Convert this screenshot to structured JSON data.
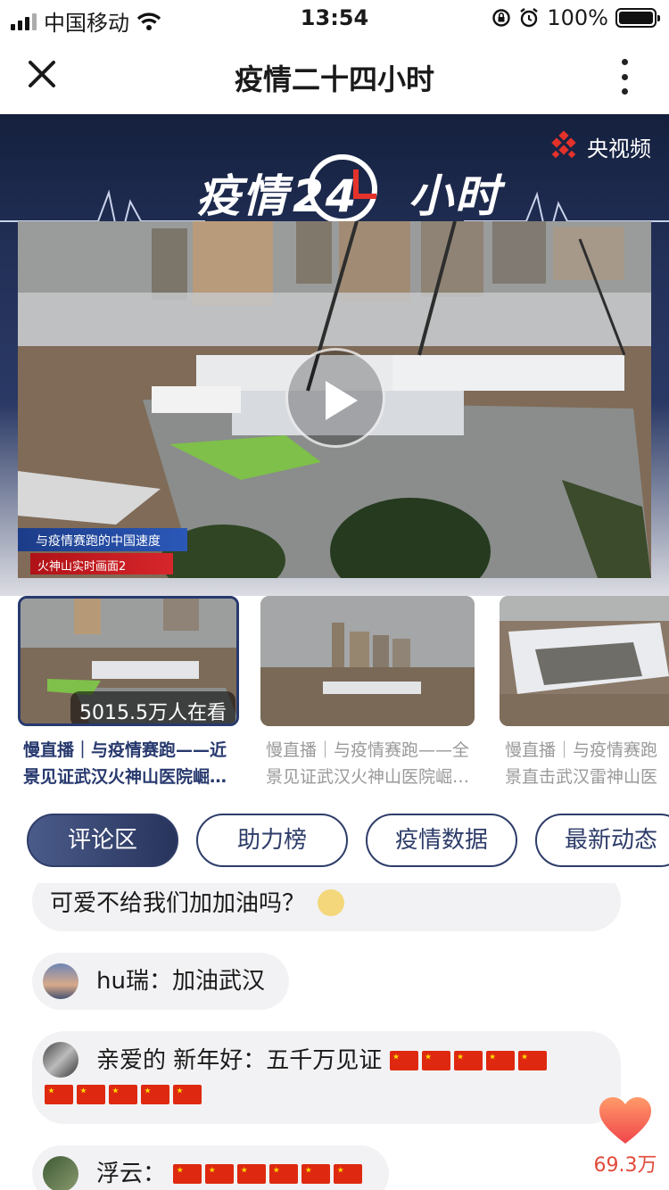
{
  "status_bar": {
    "carrier": "中国移动",
    "time": "13:54",
    "battery": "100%"
  },
  "nav": {
    "title": "疫情二十四小时"
  },
  "banner": {
    "brand": "央视频",
    "title_left": "疫情",
    "title_num": "24",
    "title_right": "小时"
  },
  "video": {
    "caption_line1": "与疫情赛跑的中国速度",
    "caption_line2": "火神山实时画面2"
  },
  "thumbnails": [
    {
      "title_line1": "慢直播｜与疫情赛跑——近",
      "title_line2": "景见证武汉火神山医院崛…",
      "viewers": "5015.5万人在看",
      "active": true
    },
    {
      "title_line1": "慢直播｜与疫情赛跑——全",
      "title_line2": "景见证武汉火神山医院崛…",
      "active": false
    },
    {
      "title_line1": "慢直播｜与疫情赛跑",
      "title_line2": "景直击武汉雷神山医",
      "active": false
    }
  ],
  "tabs": [
    {
      "label": "评论区",
      "active": true
    },
    {
      "label": "助力榜",
      "active": false
    },
    {
      "label": "疫情数据",
      "active": false
    },
    {
      "label": "最新动态",
      "active": false
    }
  ],
  "comments": [
    {
      "name": "",
      "text": "可爱不给我们加加油吗？"
    },
    {
      "name": "hu瑞：",
      "text": "加油武汉"
    },
    {
      "name": "亲爱的 新年好：",
      "text": "五千万见证"
    },
    {
      "name": "浮云：",
      "text": ""
    }
  ],
  "like": {
    "count": "69.3万"
  },
  "colors": {
    "accent": "#27396e",
    "like": "#e24a3a"
  }
}
